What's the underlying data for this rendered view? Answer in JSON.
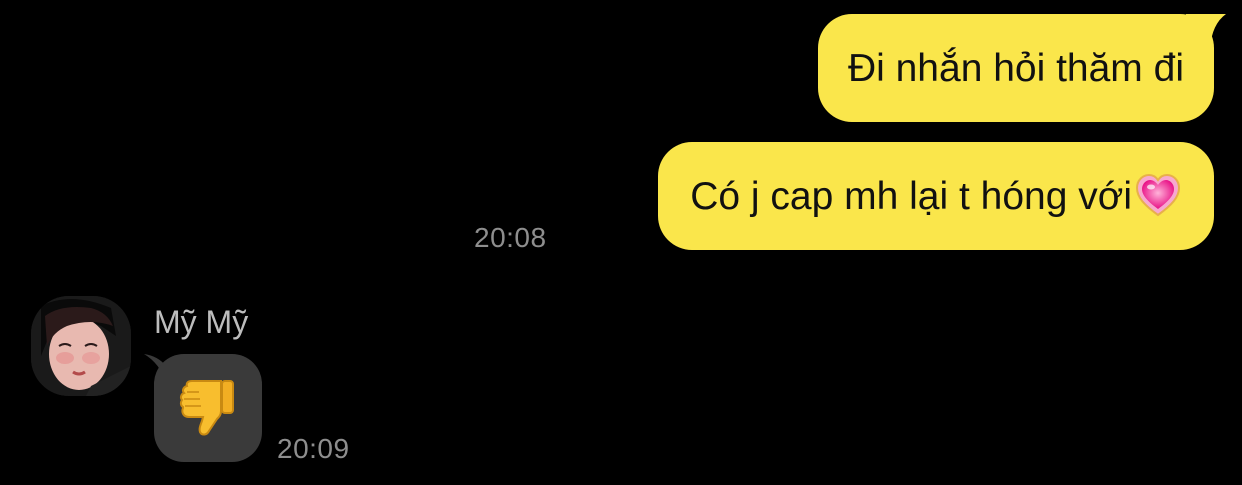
{
  "chat": {
    "messages_outgoing": [
      {
        "text": "Đi nhắn hỏi thăm đi"
      },
      {
        "text": "Có j cap mh lại t hóng với",
        "emoji": "growing-heart-emoji"
      }
    ],
    "outgoing_time": "20:08",
    "incoming": {
      "sender_name": "Mỹ Mỹ",
      "emoji": "thumbs-down-emoji",
      "time": "20:09"
    }
  },
  "colors": {
    "background": "#000000",
    "outgoing_bubble": "#FAE64B",
    "incoming_bubble": "#3A3A3A",
    "timestamp": "#8E8E8E",
    "sender_name": "#BDBDBD"
  }
}
